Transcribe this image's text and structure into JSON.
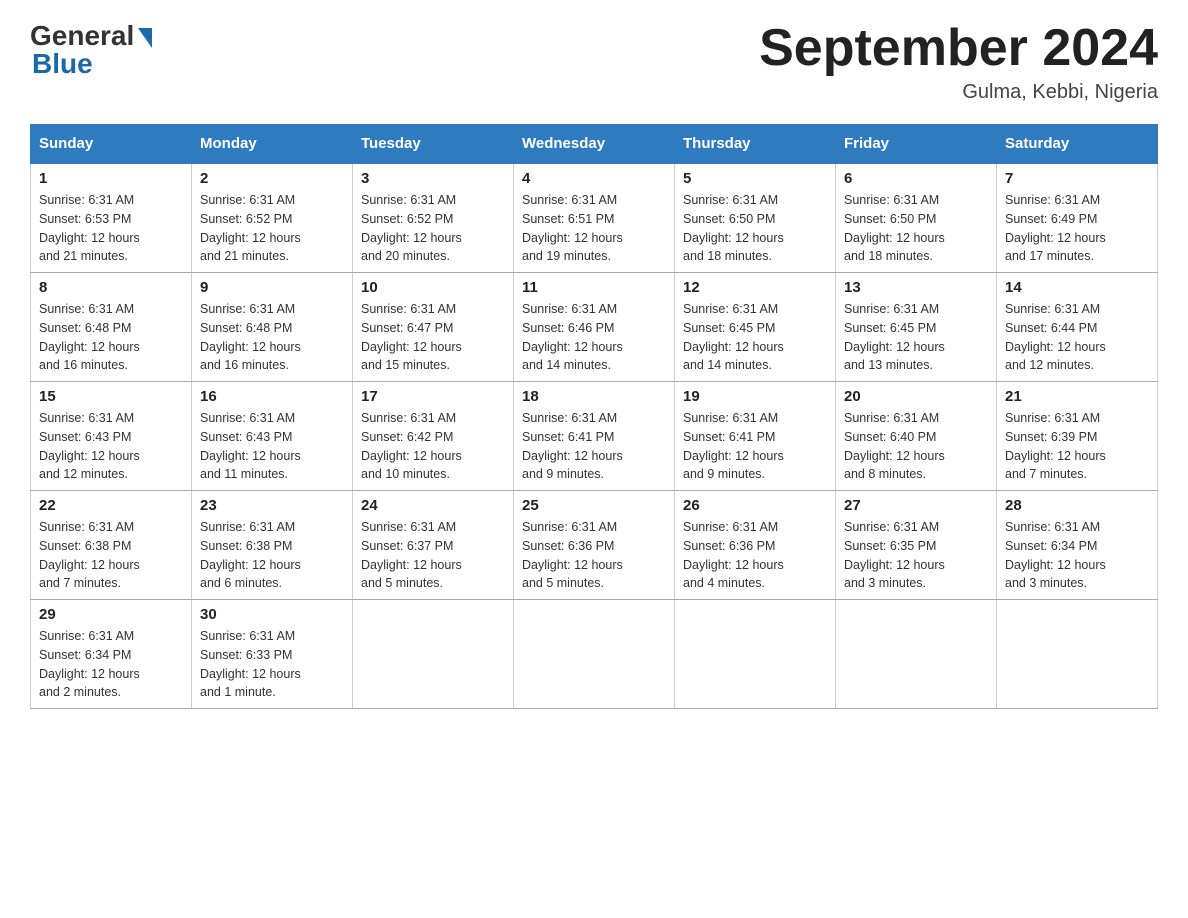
{
  "header": {
    "logo_general": "General",
    "logo_blue": "Blue",
    "month_title": "September 2024",
    "subtitle": "Gulma, Kebbi, Nigeria"
  },
  "weekdays": [
    "Sunday",
    "Monday",
    "Tuesday",
    "Wednesday",
    "Thursday",
    "Friday",
    "Saturday"
  ],
  "weeks": [
    [
      {
        "day": "1",
        "sunrise": "6:31 AM",
        "sunset": "6:53 PM",
        "daylight": "12 hours and 21 minutes."
      },
      {
        "day": "2",
        "sunrise": "6:31 AM",
        "sunset": "6:52 PM",
        "daylight": "12 hours and 21 minutes."
      },
      {
        "day": "3",
        "sunrise": "6:31 AM",
        "sunset": "6:52 PM",
        "daylight": "12 hours and 20 minutes."
      },
      {
        "day": "4",
        "sunrise": "6:31 AM",
        "sunset": "6:51 PM",
        "daylight": "12 hours and 19 minutes."
      },
      {
        "day": "5",
        "sunrise": "6:31 AM",
        "sunset": "6:50 PM",
        "daylight": "12 hours and 18 minutes."
      },
      {
        "day": "6",
        "sunrise": "6:31 AM",
        "sunset": "6:50 PM",
        "daylight": "12 hours and 18 minutes."
      },
      {
        "day": "7",
        "sunrise": "6:31 AM",
        "sunset": "6:49 PM",
        "daylight": "12 hours and 17 minutes."
      }
    ],
    [
      {
        "day": "8",
        "sunrise": "6:31 AM",
        "sunset": "6:48 PM",
        "daylight": "12 hours and 16 minutes."
      },
      {
        "day": "9",
        "sunrise": "6:31 AM",
        "sunset": "6:48 PM",
        "daylight": "12 hours and 16 minutes."
      },
      {
        "day": "10",
        "sunrise": "6:31 AM",
        "sunset": "6:47 PM",
        "daylight": "12 hours and 15 minutes."
      },
      {
        "day": "11",
        "sunrise": "6:31 AM",
        "sunset": "6:46 PM",
        "daylight": "12 hours and 14 minutes."
      },
      {
        "day": "12",
        "sunrise": "6:31 AM",
        "sunset": "6:45 PM",
        "daylight": "12 hours and 14 minutes."
      },
      {
        "day": "13",
        "sunrise": "6:31 AM",
        "sunset": "6:45 PM",
        "daylight": "12 hours and 13 minutes."
      },
      {
        "day": "14",
        "sunrise": "6:31 AM",
        "sunset": "6:44 PM",
        "daylight": "12 hours and 12 minutes."
      }
    ],
    [
      {
        "day": "15",
        "sunrise": "6:31 AM",
        "sunset": "6:43 PM",
        "daylight": "12 hours and 12 minutes."
      },
      {
        "day": "16",
        "sunrise": "6:31 AM",
        "sunset": "6:43 PM",
        "daylight": "12 hours and 11 minutes."
      },
      {
        "day": "17",
        "sunrise": "6:31 AM",
        "sunset": "6:42 PM",
        "daylight": "12 hours and 10 minutes."
      },
      {
        "day": "18",
        "sunrise": "6:31 AM",
        "sunset": "6:41 PM",
        "daylight": "12 hours and 9 minutes."
      },
      {
        "day": "19",
        "sunrise": "6:31 AM",
        "sunset": "6:41 PM",
        "daylight": "12 hours and 9 minutes."
      },
      {
        "day": "20",
        "sunrise": "6:31 AM",
        "sunset": "6:40 PM",
        "daylight": "12 hours and 8 minutes."
      },
      {
        "day": "21",
        "sunrise": "6:31 AM",
        "sunset": "6:39 PM",
        "daylight": "12 hours and 7 minutes."
      }
    ],
    [
      {
        "day": "22",
        "sunrise": "6:31 AM",
        "sunset": "6:38 PM",
        "daylight": "12 hours and 7 minutes."
      },
      {
        "day": "23",
        "sunrise": "6:31 AM",
        "sunset": "6:38 PM",
        "daylight": "12 hours and 6 minutes."
      },
      {
        "day": "24",
        "sunrise": "6:31 AM",
        "sunset": "6:37 PM",
        "daylight": "12 hours and 5 minutes."
      },
      {
        "day": "25",
        "sunrise": "6:31 AM",
        "sunset": "6:36 PM",
        "daylight": "12 hours and 5 minutes."
      },
      {
        "day": "26",
        "sunrise": "6:31 AM",
        "sunset": "6:36 PM",
        "daylight": "12 hours and 4 minutes."
      },
      {
        "day": "27",
        "sunrise": "6:31 AM",
        "sunset": "6:35 PM",
        "daylight": "12 hours and 3 minutes."
      },
      {
        "day": "28",
        "sunrise": "6:31 AM",
        "sunset": "6:34 PM",
        "daylight": "12 hours and 3 minutes."
      }
    ],
    [
      {
        "day": "29",
        "sunrise": "6:31 AM",
        "sunset": "6:34 PM",
        "daylight": "12 hours and 2 minutes."
      },
      {
        "day": "30",
        "sunrise": "6:31 AM",
        "sunset": "6:33 PM",
        "daylight": "12 hours and 1 minute."
      },
      null,
      null,
      null,
      null,
      null
    ]
  ],
  "labels": {
    "sunrise": "Sunrise:",
    "sunset": "Sunset:",
    "daylight": "Daylight:"
  }
}
